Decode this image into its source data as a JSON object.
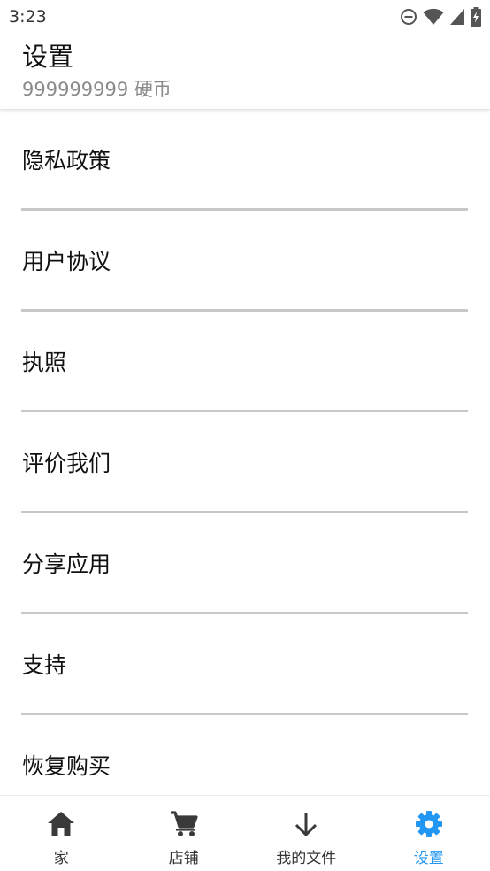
{
  "status_bar": {
    "time": "3:23",
    "icons": [
      "do-not-disturb-icon",
      "wifi-icon",
      "signal-icon",
      "battery-charging-icon"
    ]
  },
  "header": {
    "title": "设置",
    "subtitle": "999999999 硬币"
  },
  "menu": {
    "items": [
      {
        "label": "隐私政策"
      },
      {
        "label": "用户协议"
      },
      {
        "label": "执照"
      },
      {
        "label": "评价我们"
      },
      {
        "label": "分享应用"
      },
      {
        "label": "支持"
      },
      {
        "label": "恢复购买"
      }
    ]
  },
  "bottom_nav": {
    "items": [
      {
        "label": "家",
        "icon": "home-icon"
      },
      {
        "label": "店铺",
        "icon": "cart-icon"
      },
      {
        "label": "我的文件",
        "icon": "download-icon"
      },
      {
        "label": "设置",
        "icon": "gear-icon",
        "active": true
      }
    ],
    "active_color": "#2196f3",
    "inactive_color": "#333333"
  }
}
